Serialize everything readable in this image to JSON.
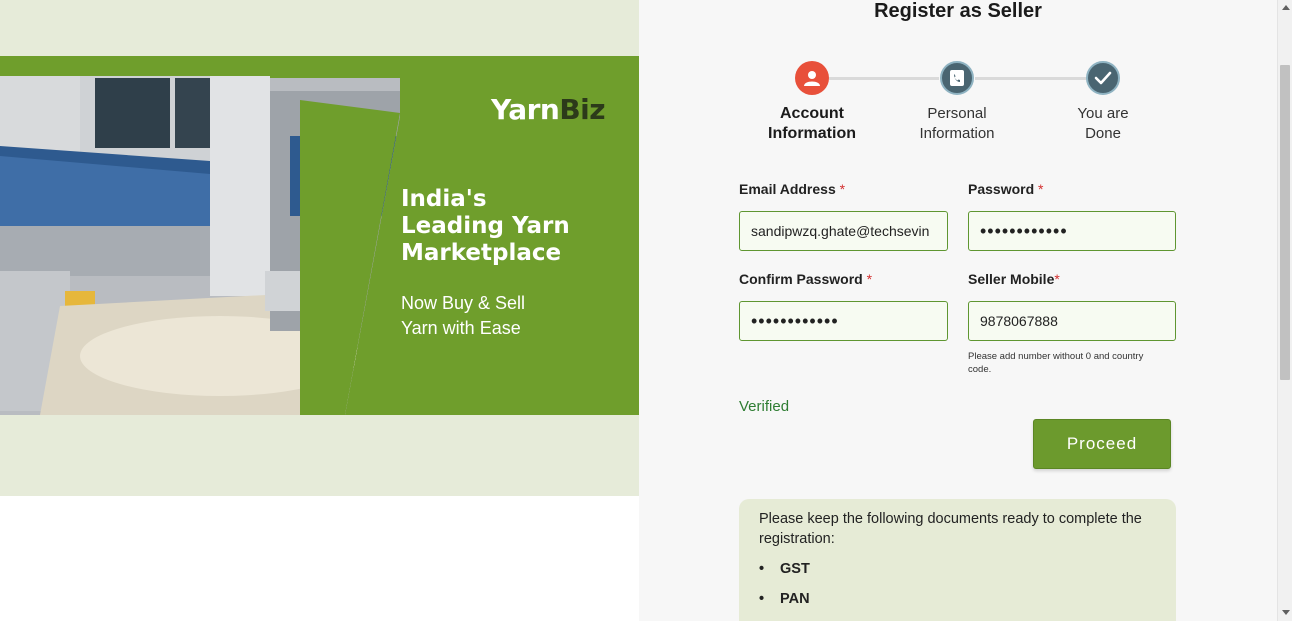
{
  "banner": {
    "brand_part1": "Yarn",
    "brand_part2": "Biz",
    "headline": [
      "India's",
      "Leading Yarn",
      "Marketplace"
    ],
    "subline": [
      "Now Buy & Sell",
      "Yarn with Ease"
    ]
  },
  "form": {
    "title": "Register as Seller",
    "steps": [
      {
        "label_1": "Account",
        "label_2": "Information",
        "icon": "user-icon",
        "status": "active",
        "color": "#e8503a"
      },
      {
        "label_1": "Personal",
        "label_2": "Information",
        "icon": "phone-icon",
        "status": "pending",
        "color": "#4a6571"
      },
      {
        "label_1": "You are",
        "label_2": "Done",
        "icon": "check-icon",
        "status": "pending",
        "color": "#4a6571"
      }
    ],
    "email": {
      "label": "Email Address",
      "required_mark": "*",
      "value": "sandipwzq.ghate@techsevin"
    },
    "password": {
      "label": "Password",
      "required_mark": "*",
      "value": "••••••••••••"
    },
    "confirm_password": {
      "label": "Confirm Password",
      "required_mark": "*",
      "value": "••••••••••••"
    },
    "mobile": {
      "label": "Seller Mobile",
      "required_mark": "*",
      "value": "9878067888",
      "hint": "Please add number without 0 and country code."
    },
    "verified_text": "Verified",
    "proceed_label": "Proceed"
  },
  "documents": {
    "intro": "Please keep the following documents ready to complete the registration:",
    "items": [
      "GST",
      "PAN"
    ]
  },
  "colors": {
    "accent": "#6f9e2c",
    "banner_bg": "#e6ebd9",
    "active_step": "#e8503a",
    "pending_step": "#4a6571"
  }
}
